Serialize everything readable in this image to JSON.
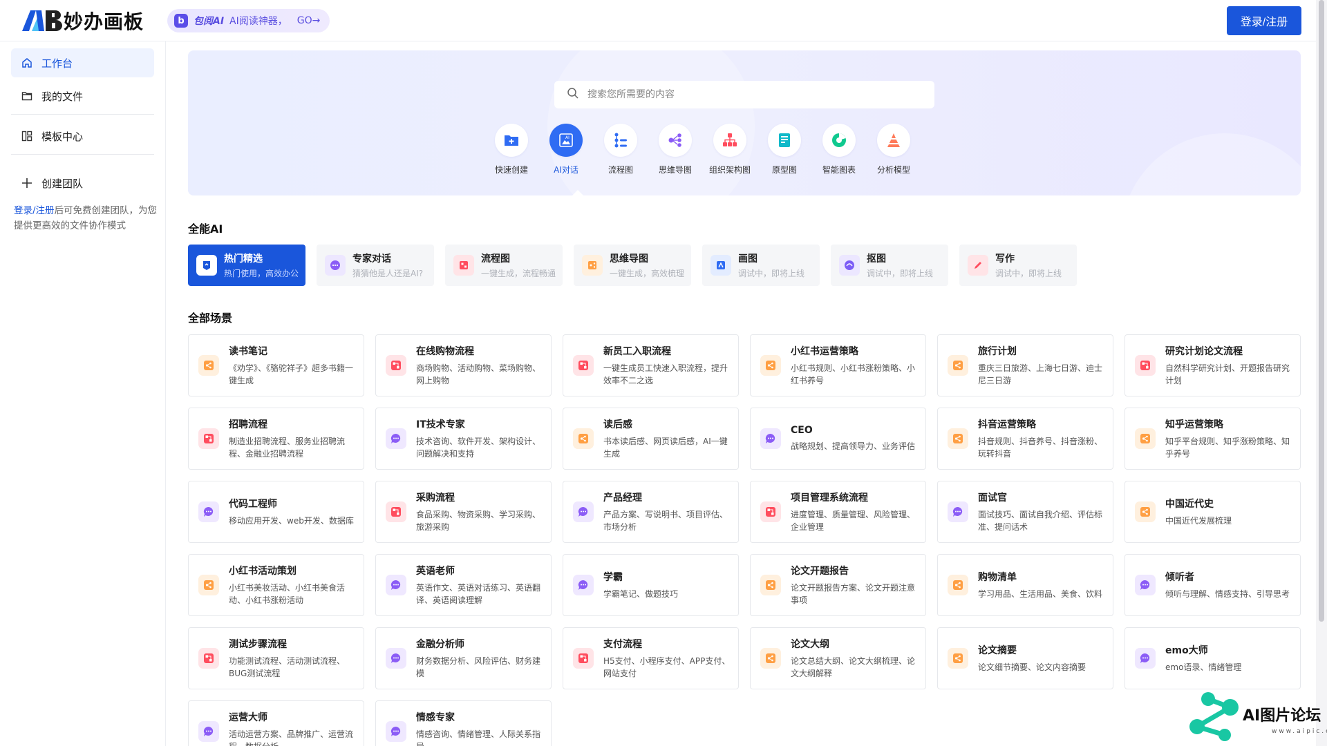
{
  "header": {
    "logo_text": "妙办画板",
    "promo_brand": "包阅AI",
    "promo_text": "AI阅读神器，",
    "promo_go": "GO→",
    "login_label": "登录/注册"
  },
  "sidebar": {
    "items": [
      {
        "label": "工作台",
        "icon": "home-icon"
      },
      {
        "label": "我的文件",
        "icon": "folder-icon"
      },
      {
        "label": "模板中心",
        "icon": "template-icon"
      },
      {
        "label": "创建团队",
        "icon": "plus-icon"
      }
    ],
    "note_link": "登录/注册",
    "note_text": "后可免费创建团队，为您提供更高效的文件协作模式"
  },
  "hero": {
    "search_placeholder": "搜索您所需要的内容",
    "tools": [
      {
        "label": "快速创建",
        "icon": "folder-plus-icon"
      },
      {
        "label": "AI对话",
        "icon": "ai-image-icon"
      },
      {
        "label": "流程图",
        "icon": "flowchart-icon"
      },
      {
        "label": "思维导图",
        "icon": "mindmap-icon"
      },
      {
        "label": "组织架构图",
        "icon": "org-chart-icon"
      },
      {
        "label": "原型图",
        "icon": "prototype-icon"
      },
      {
        "label": "智能图表",
        "icon": "pie-chart-icon"
      },
      {
        "label": "分析模型",
        "icon": "pyramid-icon"
      }
    ]
  },
  "ai_section": {
    "title": "全能AI",
    "tabs": [
      {
        "title": "热门精选",
        "sub": "热门使用，高效办公"
      },
      {
        "title": "专家对话",
        "sub": "猜猜他是人还是AI?"
      },
      {
        "title": "流程图",
        "sub": "一键生成，流程畅通"
      },
      {
        "title": "思维导图",
        "sub": "一键生成，高效梳理"
      },
      {
        "title": "画图",
        "sub": "调试中，即将上线"
      },
      {
        "title": "抠图",
        "sub": "调试中，即将上线"
      },
      {
        "title": "写作",
        "sub": "调试中，即将上线"
      }
    ]
  },
  "scenes": {
    "title": "全部场景",
    "cards": [
      {
        "title": "读书笔记",
        "desc": "《劝学》、《骆驼祥子》超多书籍一键生成",
        "type": "mind"
      },
      {
        "title": "在线购物流程",
        "desc": "商场购物、活动购物、菜场购物、网上购物",
        "type": "flow"
      },
      {
        "title": "新员工入职流程",
        "desc": "一键生成员工快速入职流程，提升效率不二之选",
        "type": "flow"
      },
      {
        "title": "小红书运营策略",
        "desc": "小红书规则、小红书涨粉策略、小红书养号",
        "type": "mind"
      },
      {
        "title": "旅行计划",
        "desc": "重庆三日旅游、上海七日游、迪士尼三日游",
        "type": "mind"
      },
      {
        "title": "研究计划论文流程",
        "desc": "自然科学研究计划、开题报告研究计划",
        "type": "flow"
      },
      {
        "title": "招聘流程",
        "desc": "制造业招聘流程、服务业招聘流程、金融业招聘流程",
        "type": "flow"
      },
      {
        "title": "IT技术专家",
        "desc": "技术咨询、软件开发、架构设计、问题解决和支持",
        "type": "chat"
      },
      {
        "title": "读后感",
        "desc": "书本读后感、网页读后感，AI一键生成",
        "type": "mind"
      },
      {
        "title": "CEO",
        "desc": "战略规划、提高领导力、业务评估",
        "type": "chat"
      },
      {
        "title": "抖音运营策略",
        "desc": "抖音规则、抖音养号、抖音涨粉、玩转抖音",
        "type": "mind"
      },
      {
        "title": "知乎运营策略",
        "desc": "知乎平台规则、知乎涨粉策略、知乎养号",
        "type": "mind"
      },
      {
        "title": "代码工程师",
        "desc": "移动应用开发、web开发、数据库",
        "type": "chat"
      },
      {
        "title": "采购流程",
        "desc": "食品采购、物资采购、学习采购、旅游采购",
        "type": "flow"
      },
      {
        "title": "产品经理",
        "desc": "产品方案、写说明书、项目评估、市场分析",
        "type": "chat"
      },
      {
        "title": "项目管理系统流程",
        "desc": "进度管理、质量管理、风险管理、企业管理",
        "type": "flow"
      },
      {
        "title": "面试官",
        "desc": "面试技巧、面试自我介绍、评估标准、提问话术",
        "type": "chat"
      },
      {
        "title": "中国近代史",
        "desc": "中国近代发展梳理",
        "type": "mind"
      },
      {
        "title": "小红书活动策划",
        "desc": "小红书美妆活动、小红书美食活动、小红书涨粉活动",
        "type": "mind"
      },
      {
        "title": "英语老师",
        "desc": "英语作文、英语对话练习、英语翻译、英语阅读理解",
        "type": "chat"
      },
      {
        "title": "学霸",
        "desc": "学霸笔记、做题技巧",
        "type": "chat"
      },
      {
        "title": "论文开题报告",
        "desc": "论文开题报告方案、论文开题注意事项",
        "type": "mind"
      },
      {
        "title": "购物清单",
        "desc": "学习用品、生活用品、美食、饮料",
        "type": "mind"
      },
      {
        "title": "倾听者",
        "desc": "倾听与理解、情感支持、引导思考",
        "type": "chat"
      },
      {
        "title": "测试步骤流程",
        "desc": "功能测试流程、活动测试流程、BUG测试流程",
        "type": "flow"
      },
      {
        "title": "金融分析师",
        "desc": "财务数据分析、风险评估、财务建模",
        "type": "chat"
      },
      {
        "title": "支付流程",
        "desc": "H5支付、小程序支付、APP支付、网站支付",
        "type": "flow"
      },
      {
        "title": "论文大纲",
        "desc": "论文总结大纲、论文大纲梳理、论文大纲解释",
        "type": "mind"
      },
      {
        "title": "论文摘要",
        "desc": "论文细节摘要、论文内容摘要",
        "type": "mind"
      },
      {
        "title": "emo大师",
        "desc": "emo语录、情绪管理",
        "type": "chat"
      },
      {
        "title": "运营大师",
        "desc": "活动运营方案、品牌推广、运营流程、数据分析",
        "type": "chat"
      },
      {
        "title": "情感专家",
        "desc": "情感咨询、情绪管理、人际关系指导",
        "type": "chat"
      }
    ]
  },
  "watermark": {
    "text": "AI图片论坛",
    "sub": "www.aipic.cc"
  },
  "colors": {
    "accent": "#1a56db",
    "mind": "#ff9f43",
    "flow": "#ff4d5e",
    "chat": "#8b5cf6"
  }
}
